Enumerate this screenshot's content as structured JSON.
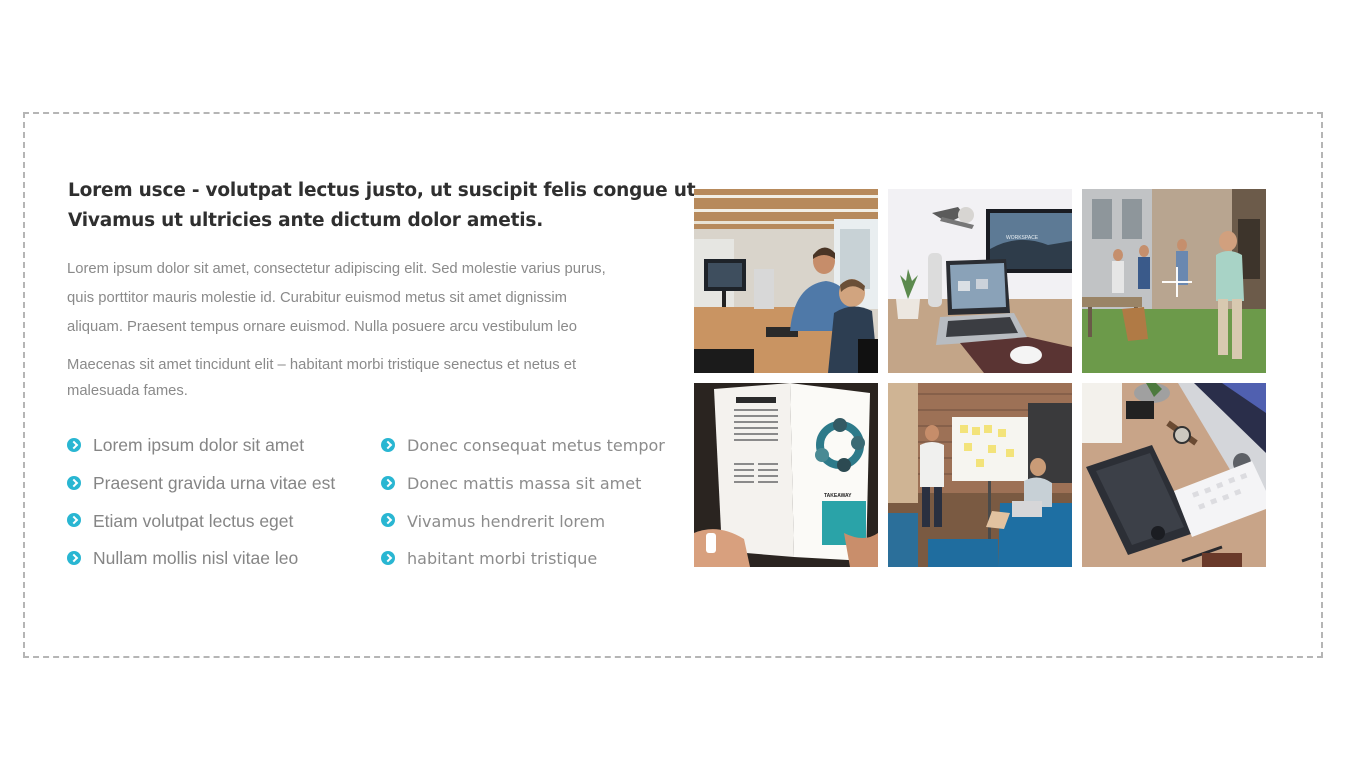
{
  "heading": {
    "line1": "Lorem usce - volutpat lectus justo, ut suscipit felis congue ut.",
    "line2": "Vivamus ut ultricies ante dictum dolor ametis."
  },
  "paragraph1": {
    "line1": "Lorem ipsum dolor sit amet, consectetur adipiscing elit. Sed molestie varius purus,",
    "line2": "quis porttitor mauris molestie id. Curabitur euismod metus sit amet dignissim",
    "line3": "aliquam. Praesent tempus ornare euismod. Nulla posuere arcu vestibulum leo"
  },
  "paragraph2": {
    "line1": "Maecenas sit amet tincidunt elit – habitant morbi tristique senectus et netus et",
    "line2": "malesuada fames."
  },
  "list_left": [
    "Lorem ipsum dolor sit amet",
    "Praesent gravida urna vitae est",
    "Etiam volutpat lectus eget",
    "Nullam mollis nisl vitae leo"
  ],
  "list_right": [
    "Donec consequat metus tempor",
    "Donec mattis massa sit amet",
    "Vivamus hendrerit lorem",
    "habitant morbi tristique"
  ],
  "colors": {
    "accent": "#29b6d2",
    "heading": "#2f2f2f",
    "body_text": "#8a8a8a",
    "frame_border": "#b5b5b5"
  },
  "gallery": {
    "photos": [
      "office-team-photo",
      "laptop-desk-photo",
      "outdoor-presentation-photo",
      "magazine-reading-photo",
      "whiteboard-meeting-photo",
      "workspace-devices-photo"
    ],
    "hover_icon": "plus-icon"
  }
}
